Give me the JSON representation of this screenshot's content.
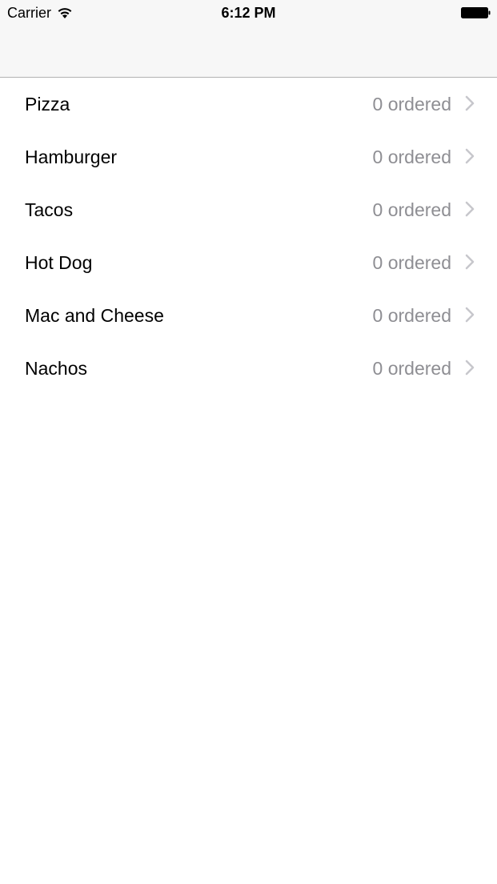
{
  "status_bar": {
    "carrier": "Carrier",
    "time": "6:12 PM",
    "icons": [
      "wifi-icon",
      "battery-icon"
    ]
  },
  "table": {
    "rows": [
      {
        "title": "Pizza",
        "detail": "0 ordered"
      },
      {
        "title": "Hamburger",
        "detail": "0 ordered"
      },
      {
        "title": "Tacos",
        "detail": "0 ordered"
      },
      {
        "title": "Hot Dog",
        "detail": "0 ordered"
      },
      {
        "title": "Mac and Cheese",
        "detail": "0 ordered"
      },
      {
        "title": "Nachos",
        "detail": "0 ordered"
      }
    ],
    "accessory_icon": "chevron-right-icon"
  },
  "colors": {
    "nav_background": "#f7f7f7",
    "detail_text": "#8e8e93",
    "chevron": "#c7c7cc",
    "separator": "#b2b2b2"
  }
}
